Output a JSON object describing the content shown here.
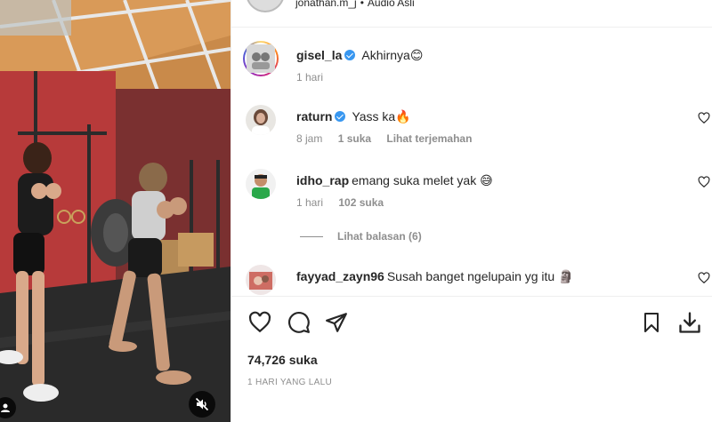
{
  "post_header": {
    "username": "jonathan.m_j",
    "separator": "•",
    "audio": "Audio Asli"
  },
  "comments": [
    {
      "username": "gisel_la",
      "verified": true,
      "text": "Akhirnya😊",
      "time": "1 hari",
      "likes": "",
      "translate": "",
      "avatar": "story-ring-avatar"
    },
    {
      "username": "raturn",
      "verified": true,
      "text": "Yass ka🔥",
      "time": "8 jam",
      "likes": "1 suka",
      "translate": "Lihat terjemahan",
      "avatar": "profile-avatar"
    },
    {
      "username": "idho_rap",
      "verified": false,
      "text": "emang suka melet yak 😅",
      "time": "1 hari",
      "likes": "102 suka",
      "translate": "",
      "avatar": "profile-avatar"
    },
    {
      "username": "fayyad_zayn96",
      "verified": false,
      "text": "Susah banget ngelupain yg itu 🗿",
      "time": "",
      "likes": "",
      "translate": "",
      "avatar": "profile-avatar"
    }
  ],
  "view_replies": "Lihat balasan (6)",
  "actions": {
    "like": "heart-icon",
    "comment": "comment-icon",
    "share": "send-icon",
    "save": "bookmark-icon",
    "download": "download-icon"
  },
  "likes_count": "74,726 suka",
  "posted_ago": "1 HARI YANG LALU",
  "media": {
    "mute": "muted-speaker-icon",
    "tag": "user-tag-icon"
  },
  "colors": {
    "text": "#262626",
    "secondary": "#8e8e8e",
    "verified": "#3897f0",
    "divider": "#efefef"
  }
}
